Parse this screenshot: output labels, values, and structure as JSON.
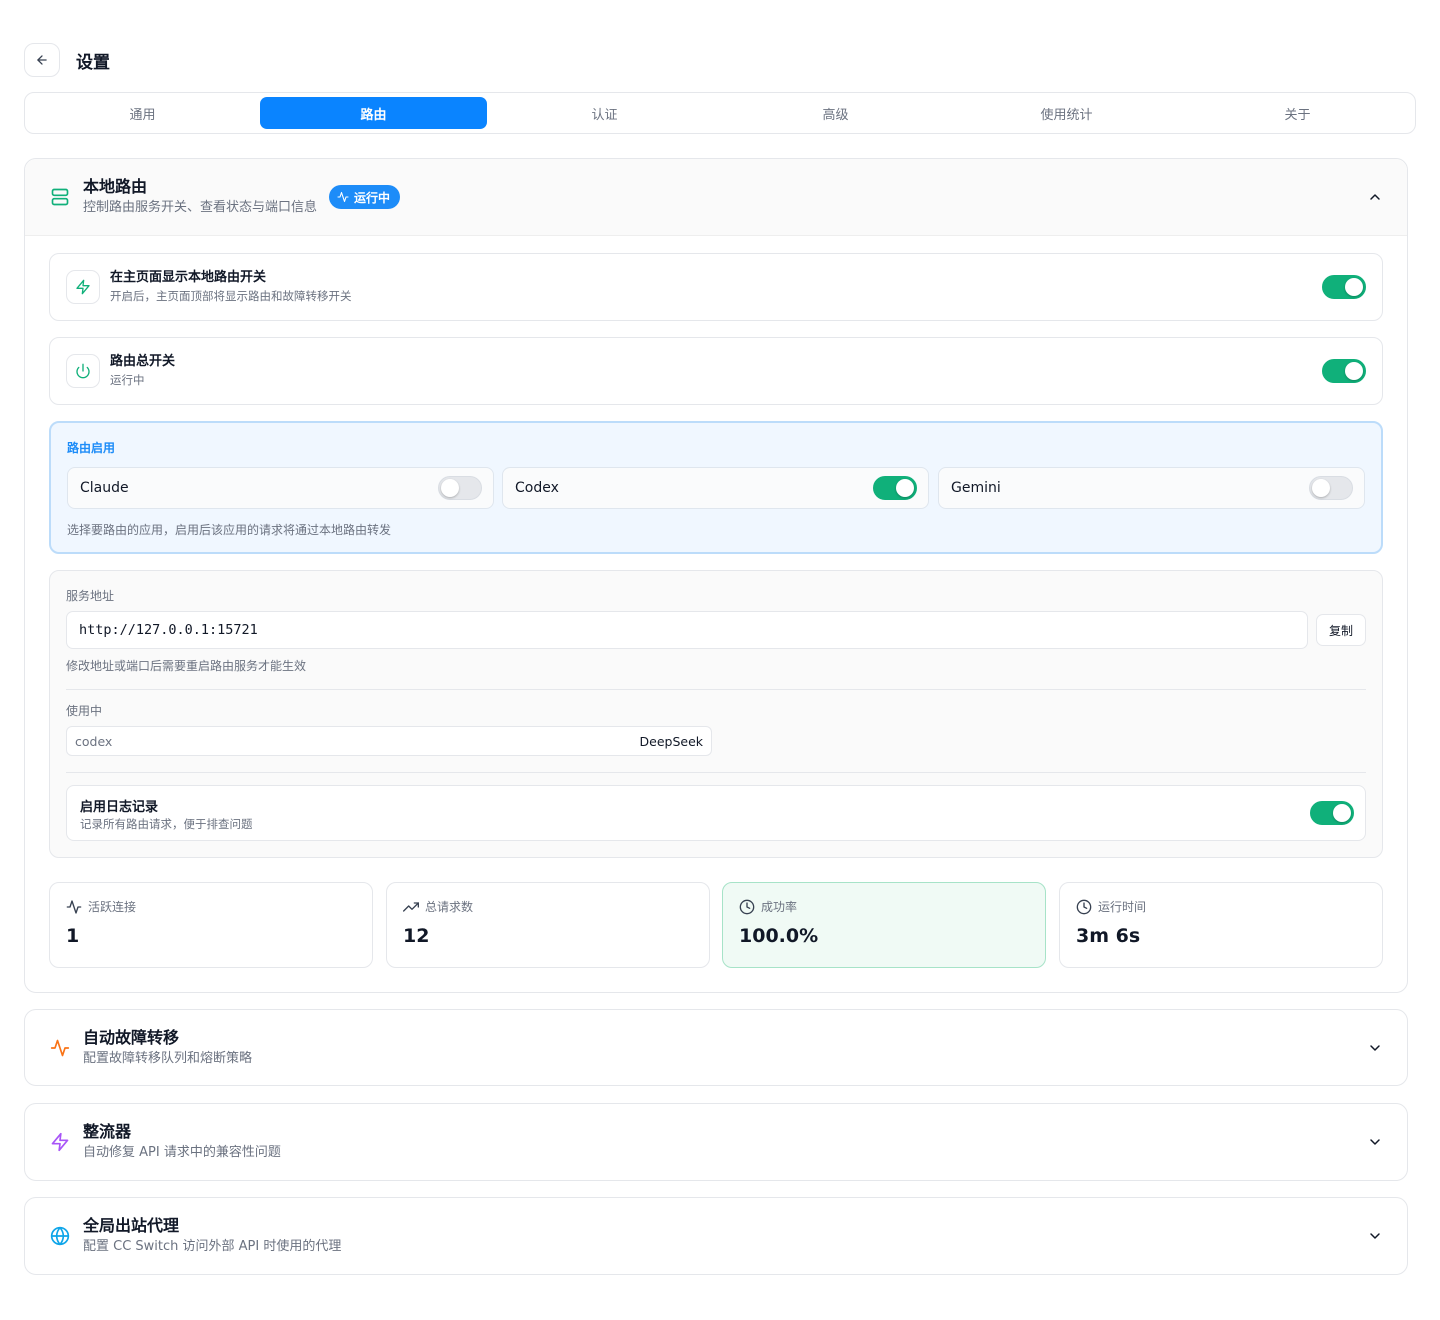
{
  "header": {
    "title": "设置"
  },
  "tabs": [
    {
      "label": "通用",
      "active": false
    },
    {
      "label": "路由",
      "active": true
    },
    {
      "label": "认证",
      "active": false
    },
    {
      "label": "高级",
      "active": false
    },
    {
      "label": "使用统计",
      "active": false
    },
    {
      "label": "关于",
      "active": false
    }
  ],
  "local_route": {
    "title": "本地路由",
    "subtitle": "控制路由服务开关、查看状态与端口信息",
    "badge": "运行中",
    "show_switch": {
      "title": "在主页面显示本地路由开关",
      "subtitle": "开启后，主页面顶部将显示路由和故障转移开关",
      "on": true
    },
    "master_switch": {
      "title": "路由总开关",
      "subtitle": "运行中",
      "on": true
    },
    "enable": {
      "title": "路由启用",
      "apps": [
        {
          "name": "Claude",
          "on": false
        },
        {
          "name": "Codex",
          "on": true
        },
        {
          "name": "Gemini",
          "on": false
        }
      ],
      "note": "选择要路由的应用，启用后该应用的请求将通过本地路由转发"
    },
    "service": {
      "label": "服务地址",
      "url": "http://127.0.0.1:15721",
      "copy_label": "复制",
      "note": "修改地址或端口后需要重启路由服务才能生效",
      "in_use_label": "使用中",
      "in_use_key": "codex",
      "in_use_value": "DeepSeek",
      "log": {
        "title": "启用日志记录",
        "subtitle": "记录所有路由请求，便于排查问题",
        "on": true
      }
    },
    "stats": [
      {
        "label": "活跃连接",
        "value": "1",
        "icon": "activity-icon"
      },
      {
        "label": "总请求数",
        "value": "12",
        "icon": "trending-up-icon"
      },
      {
        "label": "成功率",
        "value": "100.0%",
        "icon": "clock-icon"
      },
      {
        "label": "运行时间",
        "value": "3m 6s",
        "icon": "clock-icon"
      }
    ]
  },
  "failover": {
    "title": "自动故障转移",
    "subtitle": "配置故障转移队列和熔断策略",
    "icon": "activity-icon",
    "color": "#f97316"
  },
  "rectifier": {
    "title": "整流器",
    "subtitle": "自动修复 API 请求中的兼容性问题",
    "icon": "zap-icon",
    "color": "#a855f7"
  },
  "proxy": {
    "title": "全局出站代理",
    "subtitle": "配置 CC Switch 访问外部 API 时使用的代理",
    "icon": "globe-icon",
    "color": "#0ea5e9"
  },
  "colors": {
    "accent": "#0a84ff",
    "toggle_on": "#10b07a",
    "green_icon": "#10b07a"
  }
}
